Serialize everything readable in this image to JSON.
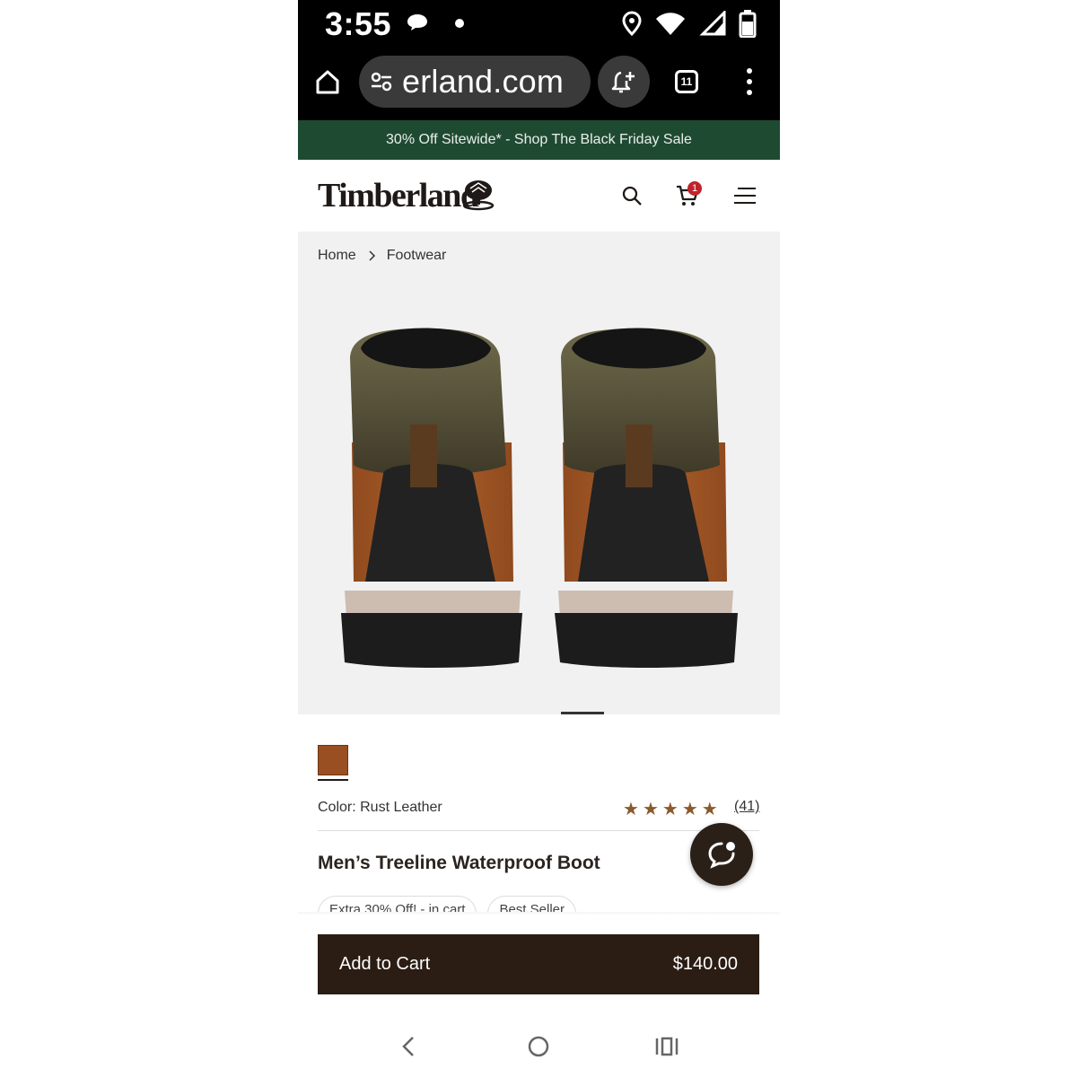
{
  "status_bar": {
    "time": "3:55",
    "icons": [
      "message-icon",
      "notification-dot",
      "location-icon",
      "wifi-icon",
      "signal-icon",
      "battery-icon"
    ]
  },
  "browser": {
    "url": "erland.com",
    "tab_count": "11",
    "icons": [
      "home-icon",
      "site-settings-icon",
      "add-alert-icon",
      "tabs-icon",
      "more-icon"
    ]
  },
  "promo": {
    "text": "30% Off Sitewide* - Shop The Black Friday Sale"
  },
  "header": {
    "logo_text": "Timberland",
    "cart_count": "1",
    "icons": [
      "search-icon",
      "cart-icon",
      "menu-icon"
    ]
  },
  "breadcrumb": {
    "items": [
      "Home",
      "Footwear"
    ]
  },
  "product": {
    "color_label": "Color: Rust Leather",
    "rating": 5,
    "reviews": "(41)",
    "title": "Men’s Treeline Waterproof Boot",
    "chips": [
      "Extra 30% Off! - in cart",
      "Best Seller"
    ],
    "price": "$140.00",
    "add_to_cart": "Add to Cart",
    "swatch_color": "#9a4f22"
  },
  "colors": {
    "promo_bg": "#1f4a32",
    "cart_button_bg": "#2b1d14",
    "star_color": "#8a5a2b",
    "badge_red": "#c0232b"
  }
}
